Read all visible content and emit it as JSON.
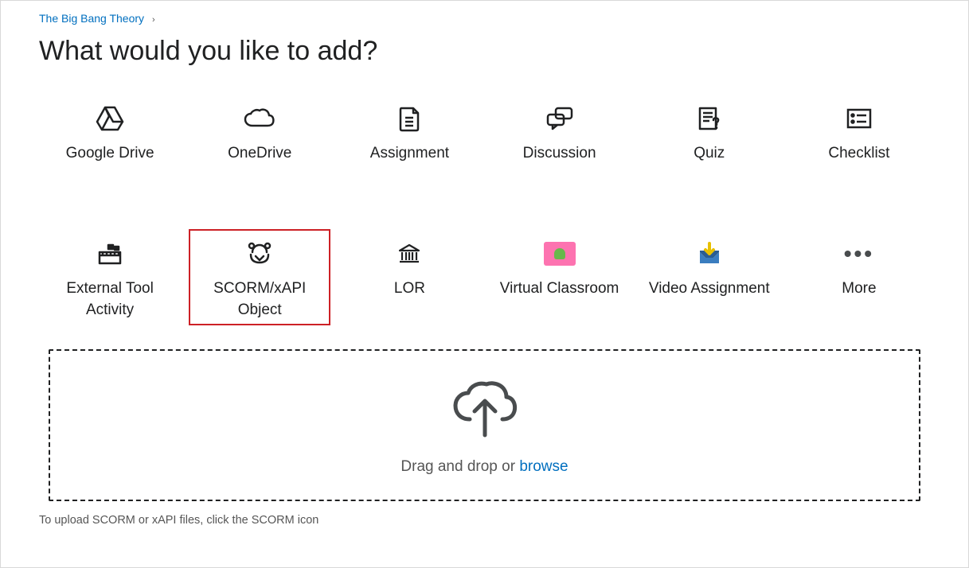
{
  "breadcrumb": {
    "course": "The Big Bang Theory"
  },
  "page_title": "What would you like to add?",
  "tiles": {
    "row1": [
      {
        "label": "Google Drive",
        "icon": "google-drive-icon",
        "selected": false
      },
      {
        "label": "OneDrive",
        "icon": "onedrive-icon",
        "selected": false
      },
      {
        "label": "Assignment",
        "icon": "assignment-icon",
        "selected": false
      },
      {
        "label": "Discussion",
        "icon": "discussion-icon",
        "selected": false
      },
      {
        "label": "Quiz",
        "icon": "quiz-icon",
        "selected": false
      },
      {
        "label": "Checklist",
        "icon": "checklist-icon",
        "selected": false
      }
    ],
    "row2": [
      {
        "label": "External Tool Activity",
        "icon": "external-tool-icon",
        "selected": false
      },
      {
        "label": "SCORM/xAPI Object",
        "icon": "scorm-icon",
        "selected": true
      },
      {
        "label": "LOR",
        "icon": "lor-icon",
        "selected": false
      },
      {
        "label": "Virtual Classroom",
        "icon": "virtual-classroom-icon",
        "selected": false
      },
      {
        "label": "Video Assignment",
        "icon": "video-assignment-icon",
        "selected": false
      },
      {
        "label": "More",
        "icon": "more-icon",
        "selected": false
      }
    ]
  },
  "dropzone": {
    "prefix": "Drag and drop or ",
    "link": "browse"
  },
  "hint": "To upload SCORM or xAPI files, click the SCORM icon"
}
